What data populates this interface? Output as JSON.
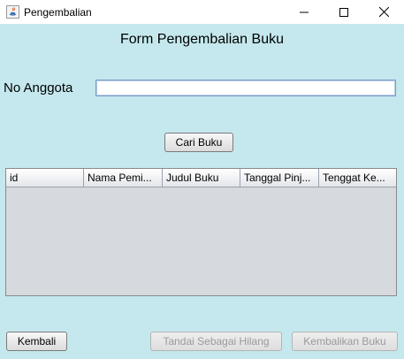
{
  "window": {
    "title": "Pengembalian",
    "controls": {
      "minimize": "—",
      "maximize": "☐",
      "close": "✕"
    }
  },
  "form": {
    "title": "Form Pengembalian Buku",
    "no_anggota_label": "No Anggota",
    "no_anggota_value": "",
    "search_button": "Cari Buku"
  },
  "table": {
    "columns": [
      "id",
      "Nama Pemi...",
      "Judul Buku",
      "Tanggal Pinj...",
      "Tenggat Ke..."
    ],
    "rows": []
  },
  "footer": {
    "back_button": "Kembali",
    "mark_lost_button": "Tandai Sebagai Hilang",
    "return_button": "Kembalikan Buku"
  },
  "colors": {
    "background": "#c4e8ed",
    "table_body": "#d6d9de"
  }
}
